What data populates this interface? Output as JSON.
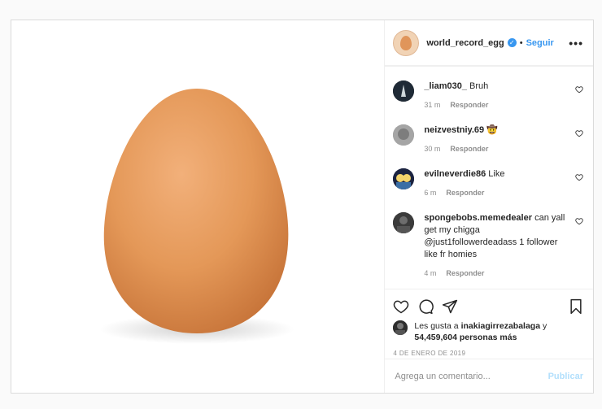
{
  "post": {
    "image_subject": "egg",
    "username": "world_record_egg",
    "separator": "•",
    "follow_label": "Seguir",
    "more_label": "•••"
  },
  "comments": [
    {
      "user": "_liam030_",
      "text": "Bruh",
      "time": "31 m",
      "reply_label": "Responder",
      "avatar": "dark-figure"
    },
    {
      "user": "neizvestniy.69",
      "text": "🤠",
      "time": "30 m",
      "reply_label": "Responder",
      "avatar": "grey-blur"
    },
    {
      "user": "evilneverdie86",
      "text": "Like",
      "time": "6 m",
      "reply_label": "Responder",
      "avatar": "cartoon-duo"
    },
    {
      "user": "spongebobs.memedealer",
      "text": "can yall get my chigga @just1followerdeadass 1 follower like fr homies",
      "time": "4 m",
      "reply_label": "Responder",
      "avatar": "dark-photo"
    }
  ],
  "likes": {
    "prefix": "Les gusta a",
    "liker": "inakiagirrezabalaga",
    "connector": "y",
    "count_text": "54,459,604 personas más"
  },
  "date": "4 DE ENERO DE 2019",
  "add_comment": {
    "placeholder": "Agrega un comentario...",
    "publish_label": "Publicar"
  },
  "colors": {
    "link_blue": "#3897f0",
    "publish_disabled": "#b2dffc",
    "meta_grey": "#8e8e8e",
    "egg": "#e0955a"
  }
}
